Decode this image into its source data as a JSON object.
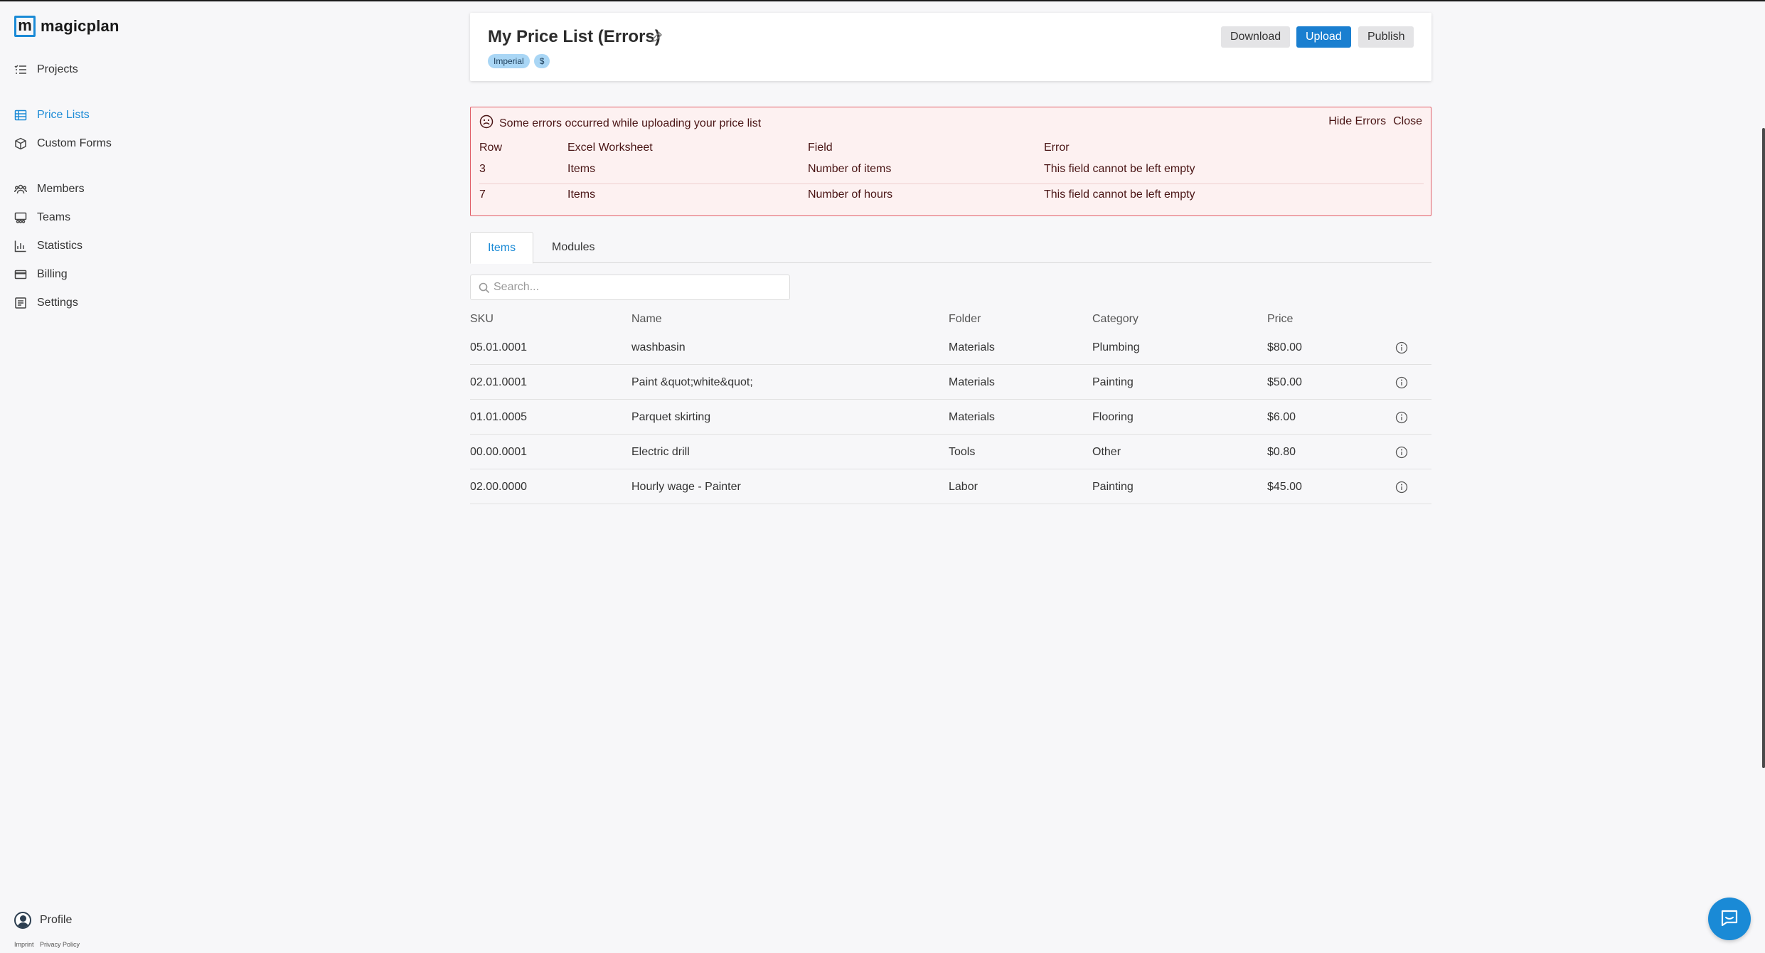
{
  "app": {
    "name": "magicplan",
    "logo_letter": "m"
  },
  "sidebar": {
    "items": [
      {
        "label": "Projects",
        "icon": "list-icon"
      },
      {
        "label": "Price Lists",
        "icon": "table-icon",
        "active": true
      },
      {
        "label": "Custom Forms",
        "icon": "cube-icon"
      },
      {
        "label": "Members",
        "icon": "users-icon"
      },
      {
        "label": "Teams",
        "icon": "team-icon"
      },
      {
        "label": "Statistics",
        "icon": "chart-icon"
      },
      {
        "label": "Billing",
        "icon": "card-icon"
      },
      {
        "label": "Settings",
        "icon": "settings-icon"
      }
    ],
    "profile_label": "Profile",
    "footer": {
      "imprint": "Imprint",
      "privacy": "Privacy Policy"
    }
  },
  "header": {
    "title": "My Price List (Errors)",
    "badges": [
      "Imperial",
      "$"
    ],
    "buttons": {
      "download": "Download",
      "upload": "Upload",
      "publish": "Publish"
    }
  },
  "errors": {
    "message": "Some errors occurred while uploading your price list",
    "hide_label": "Hide Errors",
    "close_label": "Close",
    "columns": [
      "Row",
      "Excel Worksheet",
      "Field",
      "Error"
    ],
    "rows": [
      [
        "3",
        "Items",
        "Number of items",
        "This field cannot be left empty"
      ],
      [
        "7",
        "Items",
        "Number of hours",
        "This field cannot be left empty"
      ]
    ]
  },
  "tabs": [
    {
      "label": "Items",
      "active": true
    },
    {
      "label": "Modules",
      "active": false
    }
  ],
  "search": {
    "placeholder": "Search..."
  },
  "items": {
    "columns": [
      "SKU",
      "Name",
      "Folder",
      "Category",
      "Price"
    ],
    "rows": [
      [
        "05.01.0001",
        "washbasin",
        "Materials",
        "Plumbing",
        "$80.00"
      ],
      [
        "02.01.0001",
        "Paint &quot;white&quot;",
        "Materials",
        "Painting",
        "$50.00"
      ],
      [
        "01.01.0005",
        "Parquet skirting",
        "Materials",
        "Flooring",
        "$6.00"
      ],
      [
        "00.00.0001",
        "Electric drill",
        "Tools",
        "Other",
        "$0.80"
      ],
      [
        "02.00.0000",
        "Hourly wage - Painter",
        "Labor",
        "Painting",
        "$45.00"
      ]
    ]
  },
  "colors": {
    "accent": "#1a8ad6",
    "error_border": "#e05c66",
    "error_bg": "#fdf1f1"
  }
}
